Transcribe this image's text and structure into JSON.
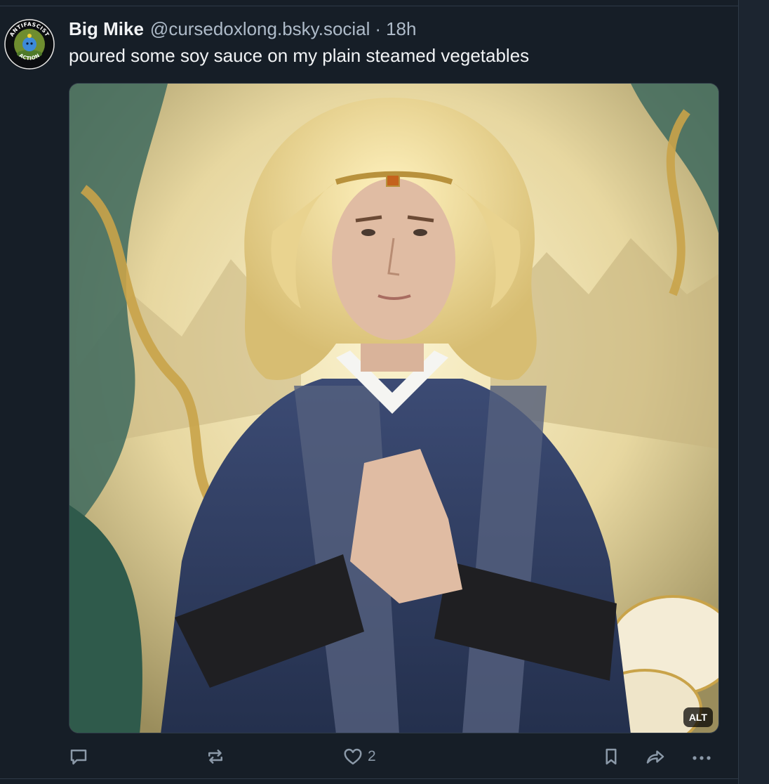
{
  "post": {
    "author_name": "Big Mike",
    "handle": "@cursedoxlong.bsky.social",
    "separator": "·",
    "time_ago": "18h",
    "text": "poured some soy sauce on my plain steamed vegetables",
    "avatar": {
      "top_text": "ANTIFASCIST",
      "bottom_text": "ACTION"
    },
    "image": {
      "alt_badge": "ALT"
    }
  },
  "actions": {
    "reply_icon": "speech-bubble-icon",
    "repost_icon": "repost-arrows-icon",
    "like_icon": "heart-icon",
    "like_count": "2",
    "bookmark_icon": "bookmark-icon",
    "share_icon": "share-arrow-icon",
    "more_icon": "ellipsis-icon"
  },
  "colors": {
    "background": "#161e27",
    "text_primary": "#f1f3f5",
    "text_secondary": "#aebbc9",
    "icon": "#8b99a8"
  }
}
